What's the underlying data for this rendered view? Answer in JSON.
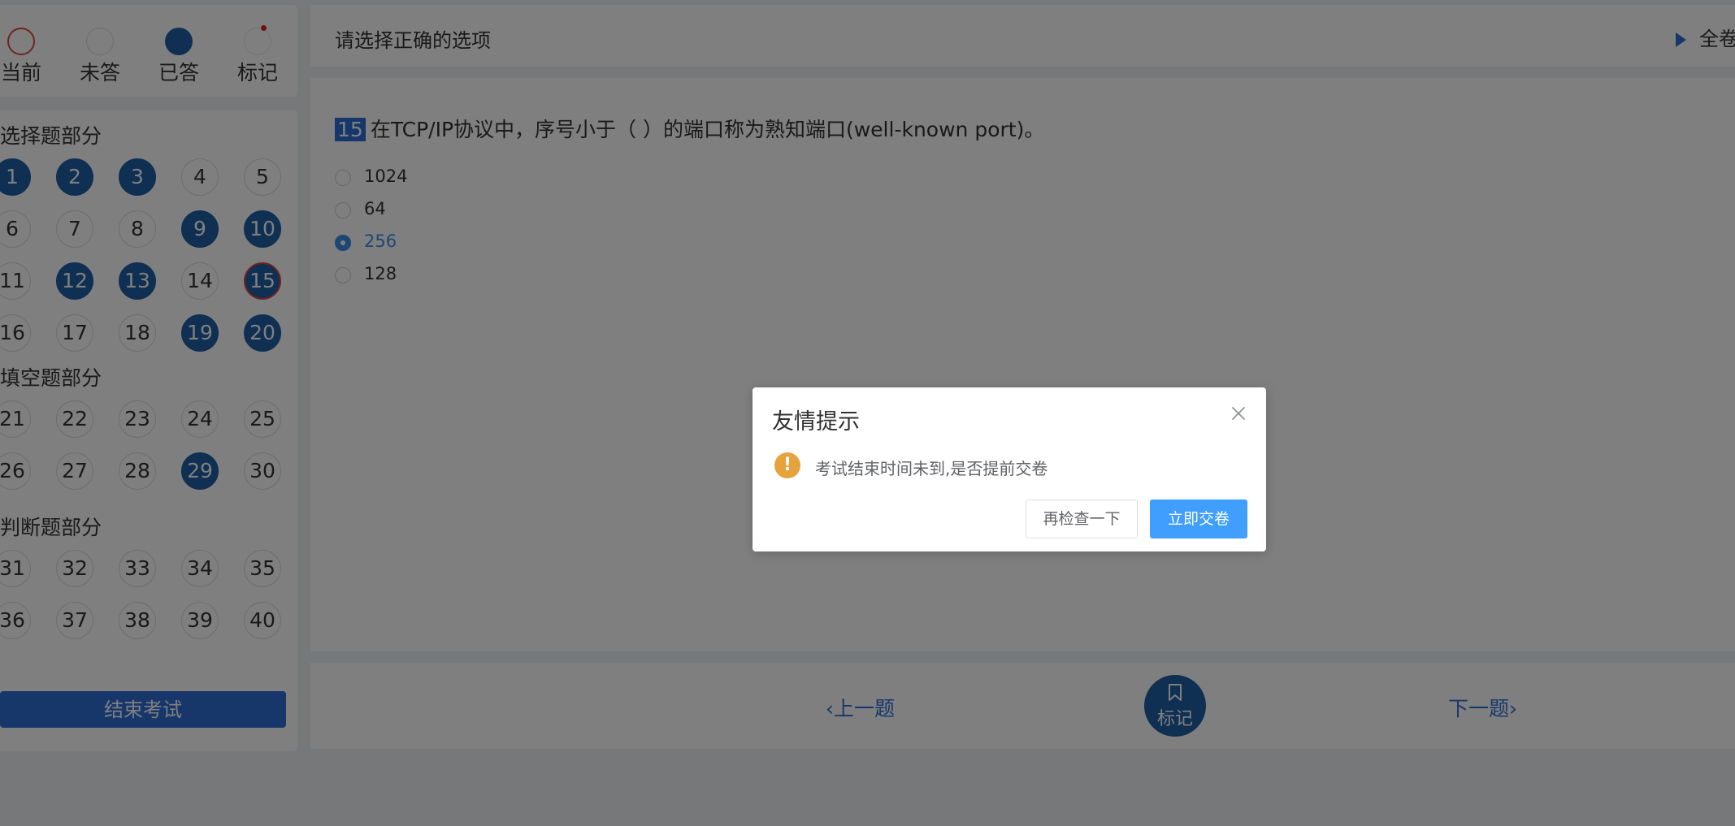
{
  "legend": {
    "current": "当前",
    "unanswered": "未答",
    "answered": "已答",
    "marked": "标记"
  },
  "sections": [
    {
      "title": "选择题部分",
      "questions": [
        {
          "n": "1",
          "state": "answered"
        },
        {
          "n": "2",
          "state": "answered"
        },
        {
          "n": "3",
          "state": "answered"
        },
        {
          "n": "4",
          "state": "unanswered"
        },
        {
          "n": "5",
          "state": "unanswered"
        },
        {
          "n": "6",
          "state": "unanswered"
        },
        {
          "n": "7",
          "state": "unanswered"
        },
        {
          "n": "8",
          "state": "unanswered"
        },
        {
          "n": "9",
          "state": "answered"
        },
        {
          "n": "10",
          "state": "answered"
        },
        {
          "n": "11",
          "state": "unanswered"
        },
        {
          "n": "12",
          "state": "answered"
        },
        {
          "n": "13",
          "state": "answered"
        },
        {
          "n": "14",
          "state": "unanswered"
        },
        {
          "n": "15",
          "state": "current-answered"
        },
        {
          "n": "16",
          "state": "unanswered"
        },
        {
          "n": "17",
          "state": "unanswered"
        },
        {
          "n": "18",
          "state": "unanswered"
        },
        {
          "n": "19",
          "state": "answered"
        },
        {
          "n": "20",
          "state": "answered"
        }
      ]
    },
    {
      "title": "填空题部分",
      "questions": [
        {
          "n": "21",
          "state": "unanswered"
        },
        {
          "n": "22",
          "state": "unanswered"
        },
        {
          "n": "23",
          "state": "unanswered"
        },
        {
          "n": "24",
          "state": "unanswered"
        },
        {
          "n": "25",
          "state": "unanswered"
        },
        {
          "n": "26",
          "state": "unanswered"
        },
        {
          "n": "27",
          "state": "unanswered"
        },
        {
          "n": "28",
          "state": "unanswered"
        },
        {
          "n": "29",
          "state": "answered"
        },
        {
          "n": "30",
          "state": "unanswered"
        }
      ]
    },
    {
      "title": "判断题部分",
      "questions": [
        {
          "n": "31",
          "state": "unanswered"
        },
        {
          "n": "32",
          "state": "unanswered"
        },
        {
          "n": "33",
          "state": "unanswered"
        },
        {
          "n": "34",
          "state": "unanswered"
        },
        {
          "n": "35",
          "state": "unanswered"
        },
        {
          "n": "36",
          "state": "unanswered"
        },
        {
          "n": "37",
          "state": "unanswered"
        },
        {
          "n": "38",
          "state": "unanswered"
        },
        {
          "n": "39",
          "state": "unanswered"
        },
        {
          "n": "40",
          "state": "unanswered"
        }
      ]
    }
  ],
  "end_exam_label": "结束考试",
  "header": {
    "title": "请选择正确的选项",
    "full_paper": "全卷"
  },
  "question": {
    "number": "15",
    "stem": "在TCP/IP协议中，序号小于（ ）的端口称为熟知端口(well-known port)。",
    "options": [
      {
        "label": "1024",
        "selected": false
      },
      {
        "label": "64",
        "selected": false
      },
      {
        "label": "256",
        "selected": true
      },
      {
        "label": "128",
        "selected": false
      }
    ]
  },
  "bottom_nav": {
    "prev": "上一题",
    "mark": "标记",
    "next": "下一题"
  },
  "dialog": {
    "title": "友情提示",
    "message": "考试结束时间未到,是否提前交卷",
    "cancel": "再检查一下",
    "confirm": "立即交卷"
  },
  "colors": {
    "answered": "#1f5fa6",
    "current_border": "#e04545",
    "primary": "#2f6fd6",
    "warning": "#e6a23c",
    "confirm_button": "#409eff"
  }
}
